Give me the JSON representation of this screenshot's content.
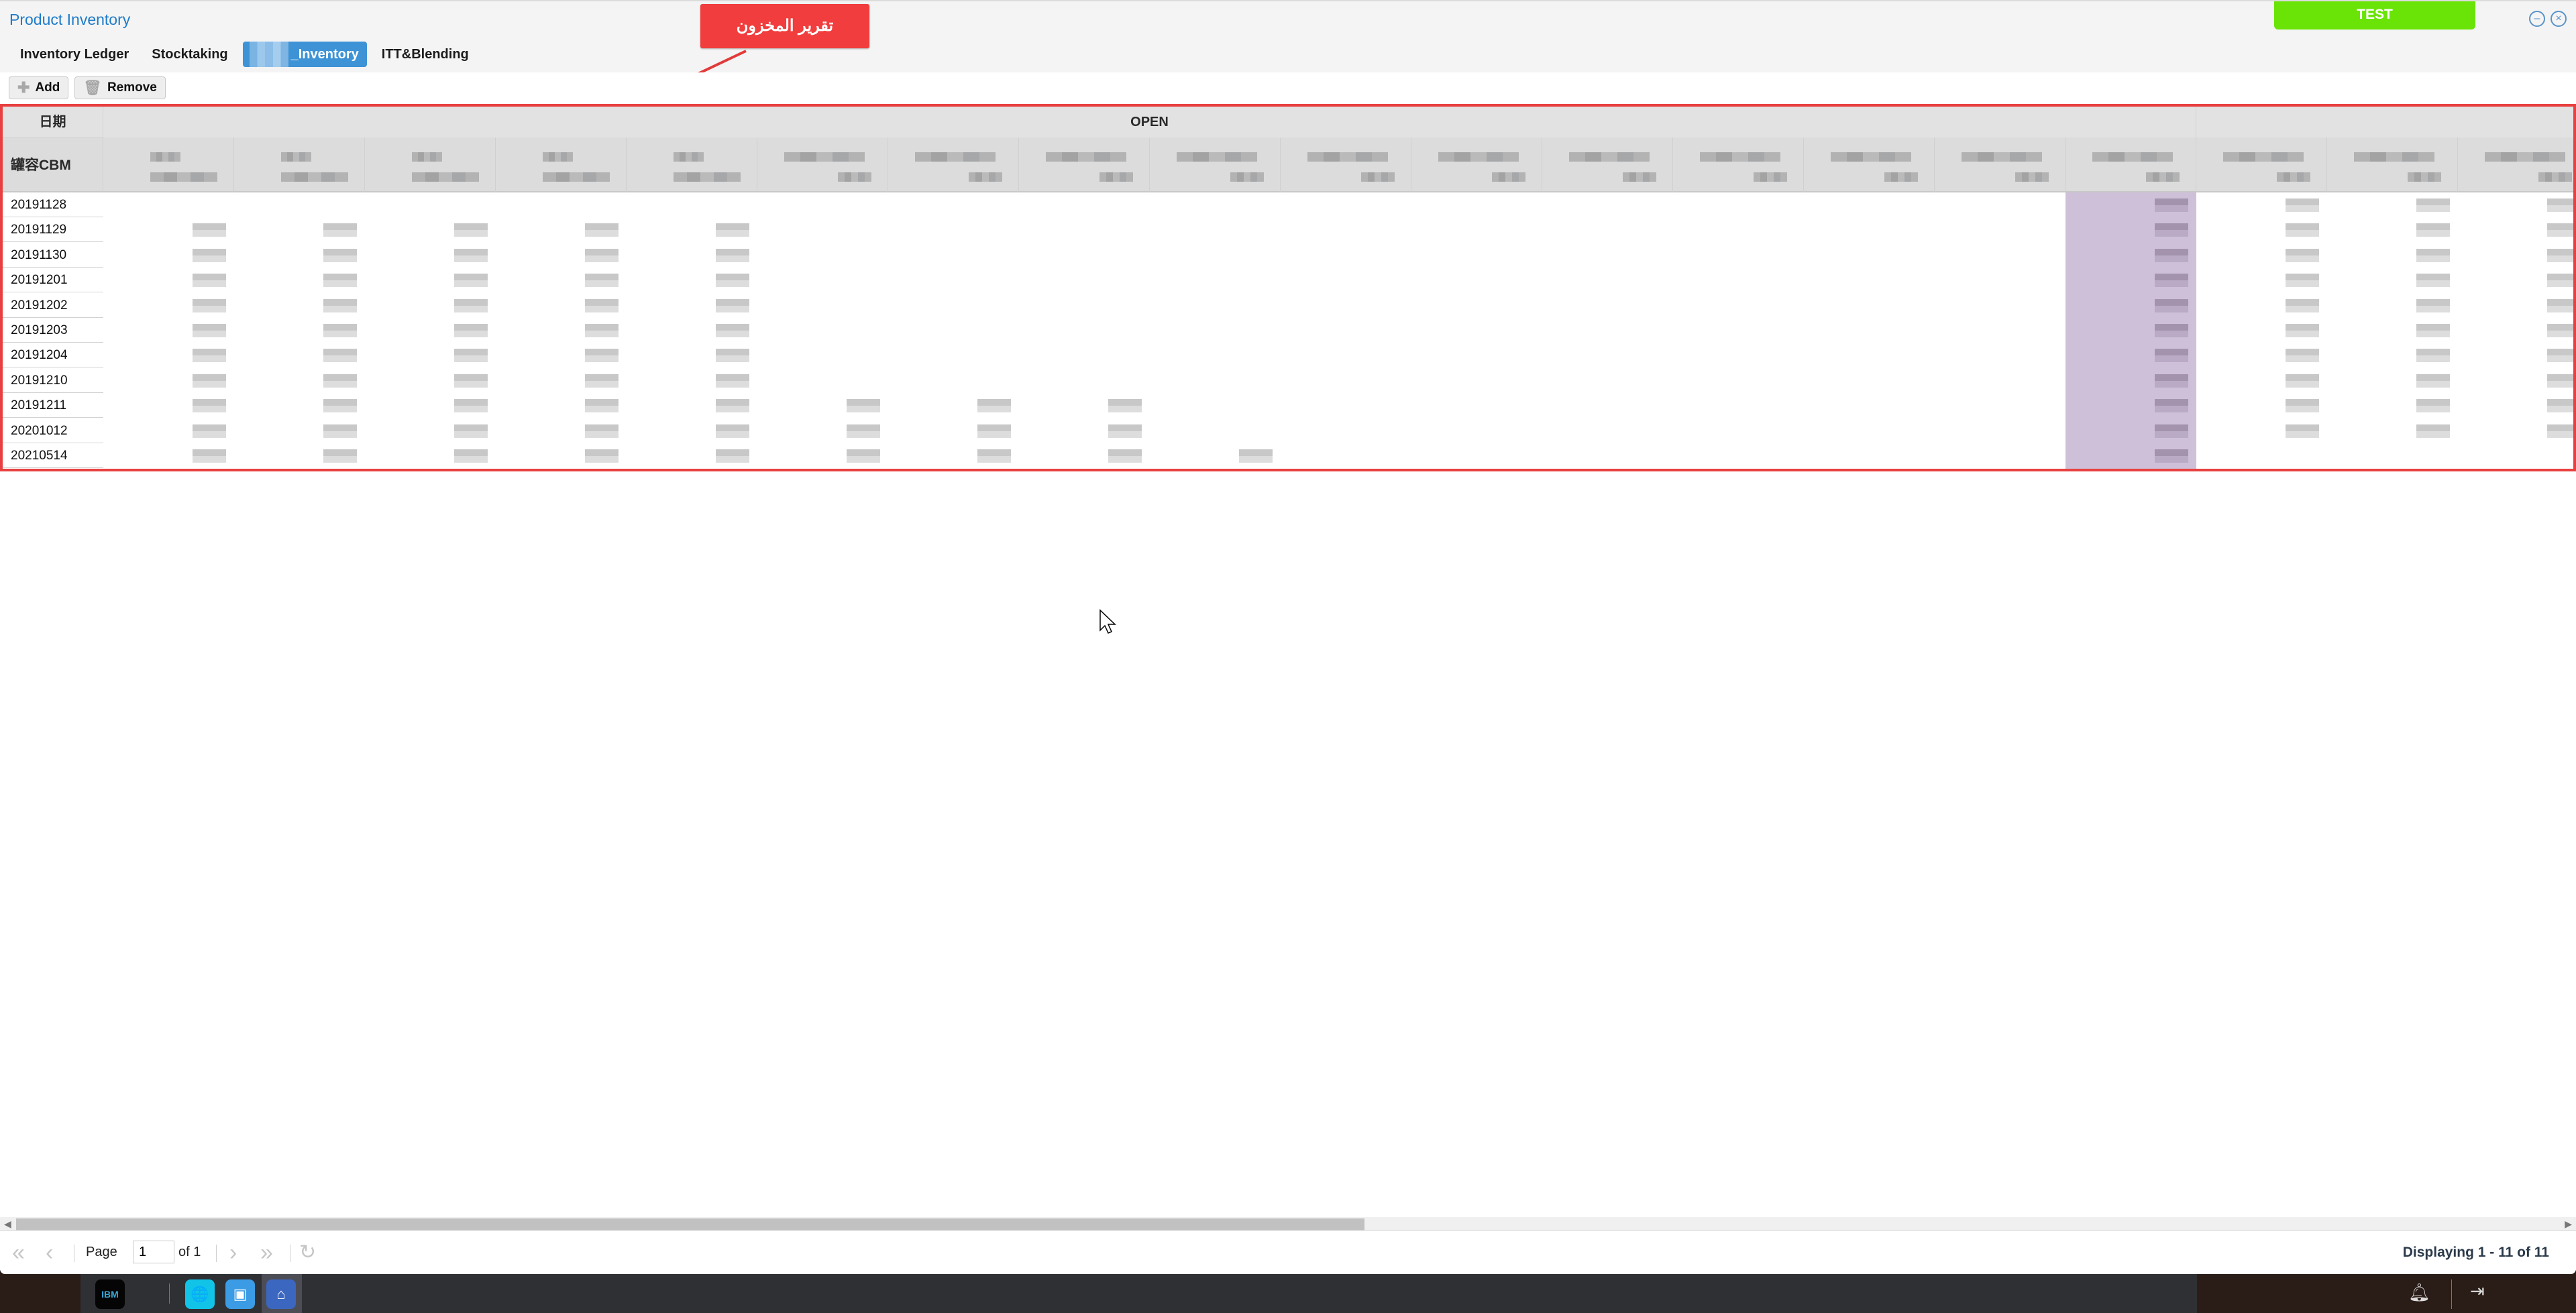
{
  "window": {
    "title": "Product Inventory",
    "env_badge": "TEST",
    "callout_text": "تقرير المخزون",
    "colors": {
      "title": "#1e7bc9",
      "callout": "#f13d3d",
      "env_badge": "#6ae407",
      "active_tab": "#3d93d6",
      "grid_border": "#e84040",
      "highlight_column": "#cfc0da"
    }
  },
  "tabs": [
    {
      "label": "Inventory Ledger",
      "active": false
    },
    {
      "label": "Stocktaking",
      "active": false
    },
    {
      "label": "_Inventory",
      "active": true,
      "redacted_prefix": true
    },
    {
      "label": "ITT&Blending",
      "active": false
    }
  ],
  "toolbar": {
    "add_label": "Add",
    "remove_label": "Remove",
    "add_icon": "plus-icon",
    "remove_icon": "trash-icon"
  },
  "grid": {
    "date_header": "日期",
    "capacity_header": "罐容CBM",
    "group_headers": [
      {
        "label": "OPEN"
      },
      {
        "label": ""
      }
    ],
    "column_headers_redacted": true,
    "rows": [
      {
        "date": "20191128"
      },
      {
        "date": "20191129"
      },
      {
        "date": "20191130"
      },
      {
        "date": "20191201"
      },
      {
        "date": "20191202"
      },
      {
        "date": "20191203"
      },
      {
        "date": "20191204"
      },
      {
        "date": "20191210"
      },
      {
        "date": "20191211"
      },
      {
        "date": "20201012"
      },
      {
        "date": "20210514"
      }
    ],
    "cell_values_redacted": true
  },
  "scrollbar": {
    "horizontal_position_fraction": 0.0,
    "visible_fraction": 0.53
  },
  "pager": {
    "page_label": "Page",
    "page_value": "1",
    "of_label": "of 1",
    "display_text": "Displaying 1 - 11 of 11"
  },
  "taskbar": {
    "apps": [
      {
        "icon": "ibm-logo-icon"
      },
      {
        "icon": "globe-app-icon"
      },
      {
        "icon": "box-app-icon"
      },
      {
        "icon": "warehouse-app-icon",
        "active": true
      }
    ],
    "tray": [
      {
        "icon": "bell-icon"
      },
      {
        "icon": "logout-icon"
      }
    ]
  }
}
